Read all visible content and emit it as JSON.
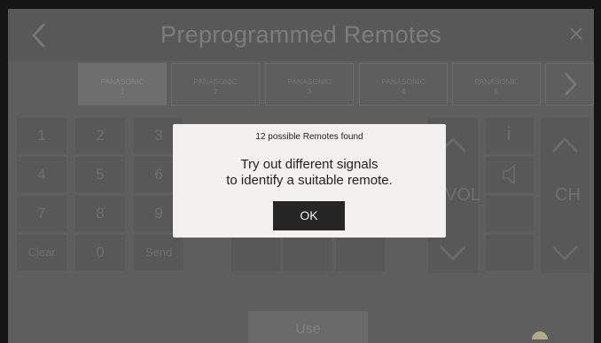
{
  "header": {
    "title": "Preprogrammed Remotes"
  },
  "tabs": [
    {
      "brand": "PANASONIC",
      "num": "1"
    },
    {
      "brand": "PANASONIC",
      "num": "2"
    },
    {
      "brand": "PANASONIC",
      "num": "3"
    },
    {
      "brand": "PANASONIC",
      "num": "4"
    },
    {
      "brand": "PANASONIC",
      "num": "5"
    }
  ],
  "keypad": {
    "keys": [
      "1",
      "2",
      "3",
      "4",
      "5",
      "6",
      "7",
      "8",
      "9",
      "Clear",
      "0",
      "Send"
    ]
  },
  "remote": {
    "vol_label": "VOL",
    "ch_label": "CH",
    "info_label": "i"
  },
  "use_button": "Use",
  "dialog": {
    "count_text": "12 possible Remotes found",
    "line1": "Try out different signals",
    "line2": "to identify a suitable remote.",
    "ok_label": "OK"
  }
}
